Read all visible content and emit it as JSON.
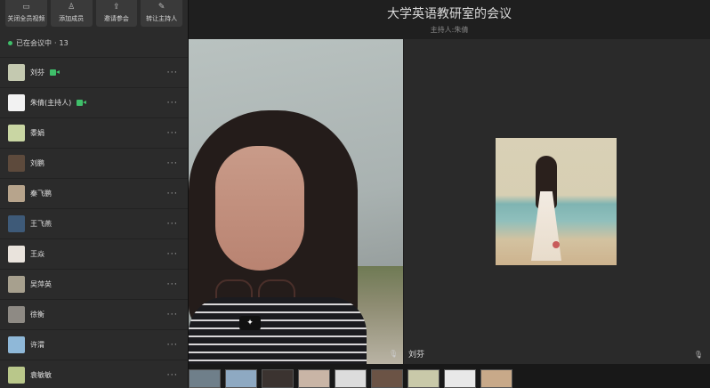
{
  "header": {
    "title": "大学英语教研室的会议",
    "subtitle": "主持人:朱倩"
  },
  "toolbar": [
    {
      "label": "关闭全员视频",
      "icon": "video-off-icon",
      "glyph": "▭"
    },
    {
      "label": "添加成员",
      "icon": "add-member-icon",
      "glyph": "♙"
    },
    {
      "label": "邀请参会",
      "icon": "share-icon",
      "glyph": "⇪"
    },
    {
      "label": "转让主持人",
      "icon": "transfer-host-icon",
      "glyph": "✎"
    }
  ],
  "status": {
    "label": "已在会议中",
    "count": "13",
    "separator": "·"
  },
  "participants": [
    {
      "name": "刘芬",
      "camera": true,
      "color": "#c4c9b0"
    },
    {
      "name": "朱倩(主持人)",
      "camera": true,
      "color": "#f2f2f2"
    },
    {
      "name": "黍娟",
      "camera": false,
      "color": "#c9d6a3"
    },
    {
      "name": "刘鹏",
      "camera": false,
      "color": "#5d4a3c"
    },
    {
      "name": "秦飞鹏",
      "camera": false,
      "color": "#b7a48c"
    },
    {
      "name": "王飞燕",
      "camera": false,
      "color": "#3e5a78"
    },
    {
      "name": "王焱",
      "camera": false,
      "color": "#e9e3dc"
    },
    {
      "name": "吴萍英",
      "camera": false,
      "color": "#a7a08e"
    },
    {
      "name": "徐衡",
      "camera": false,
      "color": "#8e8a84"
    },
    {
      "name": "许渭",
      "camera": false,
      "color": "#8fb8d8"
    },
    {
      "name": "袁敏敏",
      "camera": false,
      "color": "#b9c78a"
    }
  ],
  "more_glyph": "···",
  "main_video": {
    "badge": "✦",
    "mic": "🎙"
  },
  "side_video": {
    "name": "刘芬",
    "mic": "🎙"
  },
  "thumbnails": [
    "#6f7f8a",
    "#8ea9c2",
    "#3b3330",
    "#c9b5a6",
    "#dcdcdc",
    "#6b5345",
    "#c9c9a9",
    "#e8e8e8",
    "#c8a989"
  ]
}
